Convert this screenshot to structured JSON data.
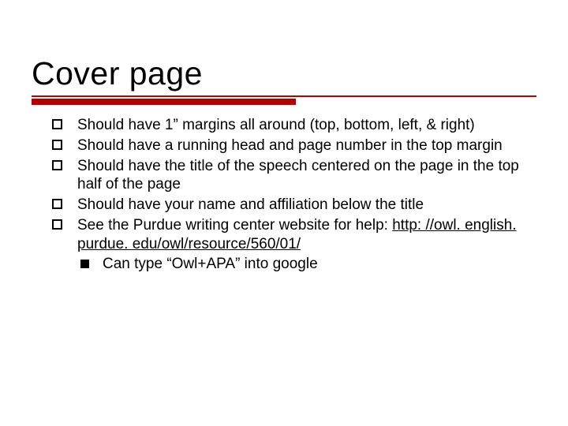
{
  "title": "Cover page",
  "bullets": [
    {
      "text": "Should have 1” margins all around (top, bottom, left, & right)"
    },
    {
      "text": "Should have a running head and page number in the top margin"
    },
    {
      "text": "Should have the title of the speech centered on the page in the top half of the page"
    },
    {
      "text": "Should have your name and affiliation below the title"
    },
    {
      "text": "See the Purdue writing center website for help: ",
      "link": "http: //owl. english. purdue. edu/owl/resource/560/01/",
      "sub": [
        {
          "text": "Can type “Owl+APA” into google"
        }
      ]
    }
  ]
}
